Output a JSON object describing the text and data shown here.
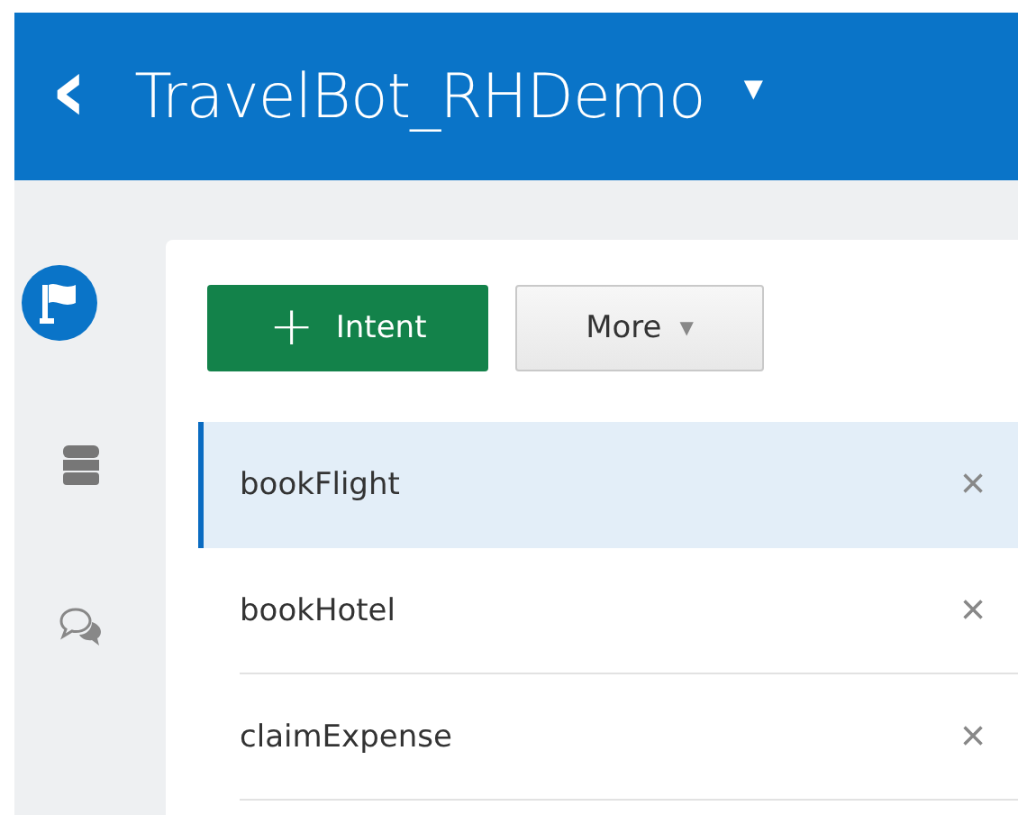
{
  "header": {
    "back": "‹",
    "title": "TravelBot_RHDemo",
    "caret": "▼"
  },
  "sidebar": {
    "items": [
      {
        "kind": "flag",
        "selected": true
      },
      {
        "kind": "database",
        "selected": false
      },
      {
        "kind": "chat",
        "selected": false
      }
    ]
  },
  "toolbar": {
    "add_button": {
      "icon": "+",
      "label": "Intent"
    },
    "more_button": {
      "label": "More",
      "caret": "▼"
    }
  },
  "intents": [
    {
      "name": "bookFlight",
      "selected": true,
      "remove": "×"
    },
    {
      "name": "bookHotel",
      "selected": false,
      "remove": "×"
    },
    {
      "name": "claimExpense",
      "selected": false,
      "remove": "×"
    }
  ]
}
